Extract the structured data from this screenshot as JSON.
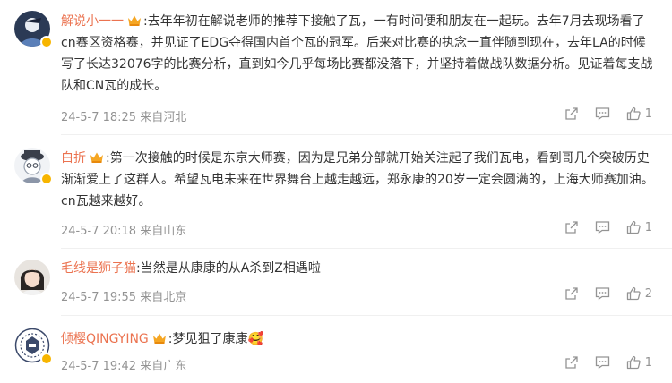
{
  "comments": [
    {
      "name": "解说小一一",
      "text": ":去年年初在解说老师的推荐下接触了瓦，一有时间便和朋友在一起玩。去年7月去现场看了cn赛区资格赛，并见证了EDG夺得国内首个瓦的冠军。后来对比赛的执念一直伴随到现在，去年LA的时候写了长达32076字的比赛分析，直到如今几乎每场比赛都没落下，并坚持着做战队数据分析。见证着每支战队和CN瓦的成长。",
      "time": "24-5-7 18:25 来自河北",
      "likes": "1"
    },
    {
      "name": "白折",
      "text": ":第一次接触的时候是东京大师赛，因为是兄弟分部就开始关注起了我们瓦电，看到哥几个突破历史渐渐爱上了这群人。希望瓦电未来在世界舞台上越走越远，郑永康的20岁一定会圆满的，上海大师赛加油。cn瓦越来越好。",
      "time": "24-5-7 20:18 来自山东",
      "likes": "1"
    },
    {
      "name": "毛线是狮子猫",
      "text": ":当然是从康康的从A杀到Z相遇啦",
      "time": "24-5-7 19:55 来自北京",
      "likes": "2"
    },
    {
      "name": "倾樱QINGYING",
      "text": ":梦见狙了康康",
      "emoji": "🥰",
      "time": "24-5-7 19:42 来自广东",
      "likes": "1"
    }
  ],
  "icons": {
    "share": "share-icon",
    "comment": "comment-icon",
    "like": "like-icon",
    "crown": "crown-icon",
    "verified": "verified-badge-icon"
  },
  "colors": {
    "name": "#eb7350",
    "text": "#333333",
    "meta": "#939393",
    "badge": "#f7b500"
  }
}
